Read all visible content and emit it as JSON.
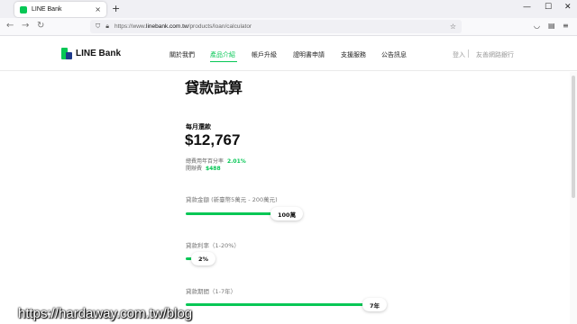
{
  "browser": {
    "tab_title": "LINE Bank",
    "tab_close": "×",
    "new_tab": "+",
    "win_minimize": "—",
    "win_maximize": "☐",
    "win_close": "✕",
    "back": "←",
    "forward": "→",
    "reload": "↻",
    "url_prefix": "https://www.",
    "url_domain": "linebank.com.tw",
    "url_path": "/products/loan/calculator",
    "star": "☆"
  },
  "site": {
    "brand": "LINE Bank",
    "brand_colors": {
      "green": "#06c755",
      "navy": "#1e3a8a"
    },
    "menu": [
      {
        "label": "關於我們",
        "active": false
      },
      {
        "label": "產品介紹",
        "active": true
      },
      {
        "label": "帳戶升級",
        "active": false
      },
      {
        "label": "證明書申請",
        "active": false
      },
      {
        "label": "支援服務",
        "active": false
      },
      {
        "label": "公告訊息",
        "active": false
      }
    ],
    "login": "登入",
    "internet_banking": "友善網路銀行"
  },
  "calculator": {
    "title": "貸款試算",
    "monthly_label": "每月還款",
    "monthly_amount": "$12,767",
    "apr_label": "總費用年百分率",
    "apr_value": "2.01%",
    "fee_label": "開辦費",
    "fee_value": "$488",
    "sliders": [
      {
        "label": "貸款金額 (新臺幣5萬元 - 200萬元)",
        "value": "100萬",
        "fraction": 0.49
      },
      {
        "label": "貸款利率（1-20%）",
        "value": "2%",
        "fraction": 0.05
      },
      {
        "label": "貸款期間（1-7年）",
        "value": "7年",
        "fraction": 1.0
      }
    ]
  },
  "watermark": "https://hardaway.com.tw/blog"
}
